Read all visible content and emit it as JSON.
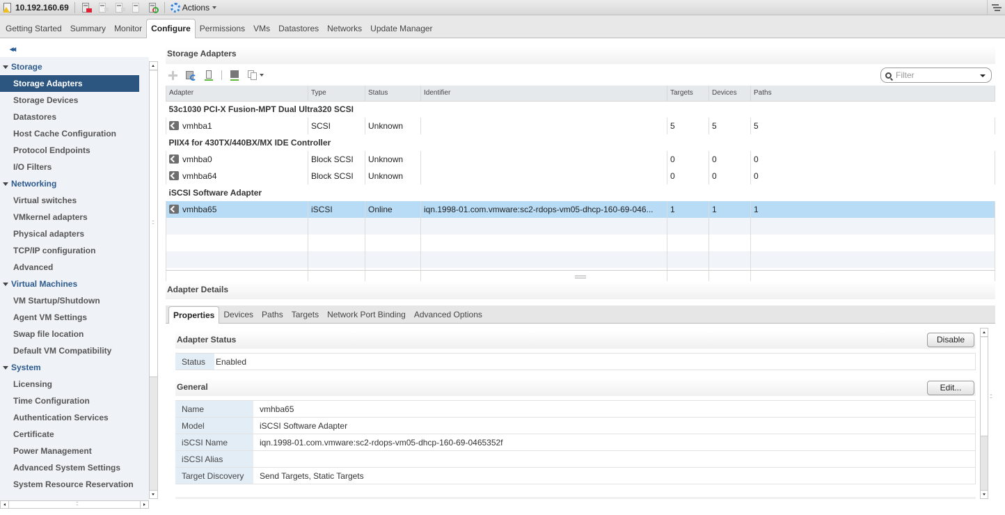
{
  "topbar": {
    "host": "10.192.160.69",
    "actions_label": "Actions"
  },
  "tabs": [
    {
      "label": "Getting Started"
    },
    {
      "label": "Summary"
    },
    {
      "label": "Monitor"
    },
    {
      "label": "Configure",
      "active": true
    },
    {
      "label": "Permissions"
    },
    {
      "label": "VMs"
    },
    {
      "label": "Datastores"
    },
    {
      "label": "Networks"
    },
    {
      "label": "Update Manager"
    }
  ],
  "nav": {
    "collapse_glyph": "◂◂",
    "groups": [
      {
        "label": "Storage",
        "items": [
          "Storage Adapters",
          "Storage Devices",
          "Datastores",
          "Host Cache Configuration",
          "Protocol Endpoints",
          "I/O Filters"
        ]
      },
      {
        "label": "Networking",
        "items": [
          "Virtual switches",
          "VMkernel adapters",
          "Physical adapters",
          "TCP/IP configuration",
          "Advanced"
        ]
      },
      {
        "label": "Virtual Machines",
        "items": [
          "VM Startup/Shutdown",
          "Agent VM Settings",
          "Swap file location",
          "Default VM Compatibility"
        ]
      },
      {
        "label": "System",
        "items": [
          "Licensing",
          "Time Configuration",
          "Authentication Services",
          "Certificate",
          "Power Management",
          "Advanced System Settings",
          "System Resource Reservation"
        ]
      }
    ],
    "selected": "Storage Adapters"
  },
  "storage_adapters": {
    "title": "Storage Adapters",
    "filter_placeholder": "Filter",
    "columns": [
      "Adapter",
      "Type",
      "Status",
      "Identifier",
      "Targets",
      "Devices",
      "Paths"
    ],
    "groups": [
      {
        "name": "53c1030 PCI-X Fusion-MPT Dual Ultra320 SCSI",
        "rows": [
          {
            "adapter": "vmhba1",
            "type": "SCSI",
            "status": "Unknown",
            "identifier": "",
            "targets": "5",
            "devices": "5",
            "paths": "5"
          }
        ]
      },
      {
        "name": "PIIX4 for 430TX/440BX/MX IDE Controller",
        "rows": [
          {
            "adapter": "vmhba0",
            "type": "Block SCSI",
            "status": "Unknown",
            "identifier": "",
            "targets": "0",
            "devices": "0",
            "paths": "0"
          },
          {
            "adapter": "vmhba64",
            "type": "Block SCSI",
            "status": "Unknown",
            "identifier": "",
            "targets": "0",
            "devices": "0",
            "paths": "0"
          }
        ]
      },
      {
        "name": "iSCSI Software Adapter",
        "rows": [
          {
            "adapter": "vmhba65",
            "type": "iSCSI",
            "status": "Online",
            "identifier": "iqn.1998-01.com.vmware:sc2-rdops-vm05-dhcp-160-69-046...",
            "targets": "1",
            "devices": "1",
            "paths": "1",
            "selected": true
          }
        ]
      }
    ]
  },
  "details": {
    "title": "Adapter Details",
    "tabs": [
      "Properties",
      "Devices",
      "Paths",
      "Targets",
      "Network Port Binding",
      "Advanced Options"
    ],
    "active_tab": "Properties",
    "adapter_status": {
      "title": "Adapter Status",
      "button": "Disable",
      "rows": [
        {
          "key": "Status",
          "value": "Enabled"
        }
      ]
    },
    "general": {
      "title": "General",
      "button": "Edit...",
      "rows": [
        {
          "key": "Name",
          "value": "vmhba65"
        },
        {
          "key": "Model",
          "value": "iSCSI Software Adapter"
        },
        {
          "key": "iSCSI Name",
          "value": "iqn.1998-01.com.vmware:sc2-rdops-vm05-dhcp-160-69-0465352f"
        },
        {
          "key": "iSCSI Alias",
          "value": ""
        },
        {
          "key": "Target Discovery",
          "value": "Send Targets, Static Targets"
        }
      ]
    }
  },
  "colors": {
    "nav_selected": "#2c5580",
    "nav_group": "#2d5a8d",
    "row_selected": "#b8dcf6",
    "prop_key_bg": "#e3edf6"
  }
}
